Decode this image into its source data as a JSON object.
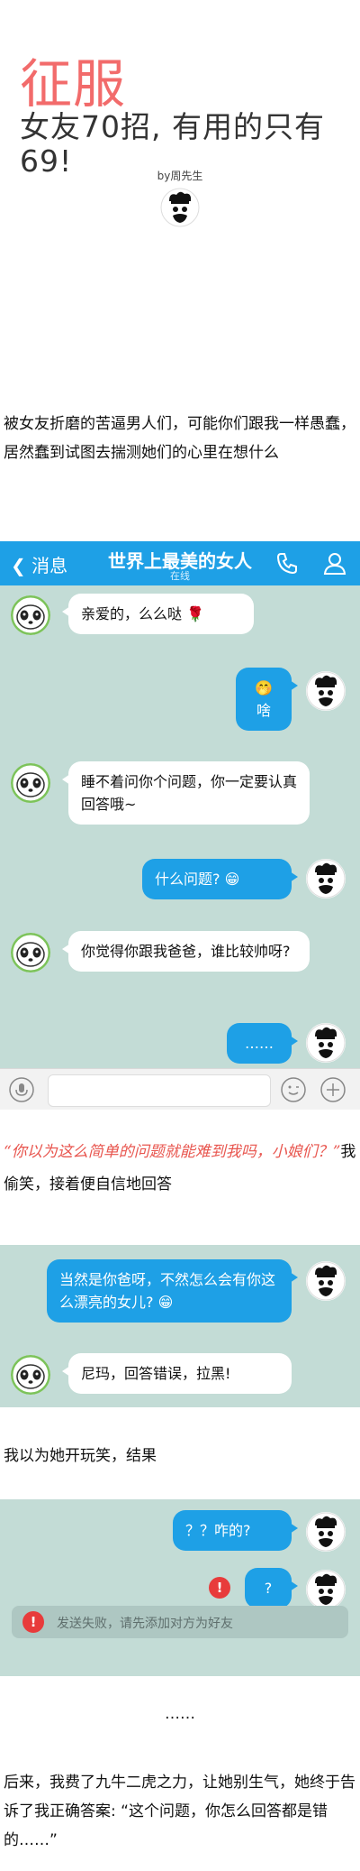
{
  "hero": {
    "title": "征服",
    "subtitle": "女友70招, 有用的只有69!",
    "byline": "by周先生"
  },
  "intro": "被女友折磨的苦逼男人们，可能你们跟我一样愚蠢，居然蠢到试图去揣测她们的心里在想什么",
  "chat1": {
    "back_label": "消息",
    "contact_name": "世界上最美的女人",
    "status": "在线",
    "messages": [
      {
        "side": "left",
        "text": "亲爱的，么么哒 🌹"
      },
      {
        "side": "right",
        "emoji": "🤭",
        "text": "啥"
      },
      {
        "side": "left",
        "text": "睡不着问你个问题，你一定要认真回答哦~"
      },
      {
        "side": "right",
        "text": "什么问题? 😁"
      },
      {
        "side": "left",
        "text": "你觉得你跟我爸爸，谁比较帅呀?"
      },
      {
        "side": "right",
        "text": "……"
      }
    ]
  },
  "quote": {
    "handwritten": "“你以为这么简单的问题就能难到我吗，小娘们？”",
    "rest": "我偷笑，接着便自信地回答"
  },
  "chat2": {
    "messages": [
      {
        "side": "right",
        "text": "当然是你爸呀，不然怎么会有你这么漂亮的女儿? 😁"
      },
      {
        "side": "left",
        "text": "尼玛，回答错误，拉黑!"
      }
    ]
  },
  "middle_text": "我以为她开玩笑，结果",
  "chat3": {
    "messages": [
      {
        "side": "right",
        "text": "？？咋的?"
      },
      {
        "side": "right",
        "text": "?"
      }
    ],
    "fail_mark": "!",
    "system_message": "发送失败，请先添加对方为好友"
  },
  "ellipsis": "……",
  "ending": "后来，我费了九牛二虎之力，让她别生气，她终于告诉了我正确答案: “这个问题，你怎么回答都是错的……”",
  "colors": {
    "accent": "#1ea0e6",
    "title": "#f26b6b",
    "chat_bg": "#c3dcd6",
    "handwritten": "#e8554e"
  }
}
